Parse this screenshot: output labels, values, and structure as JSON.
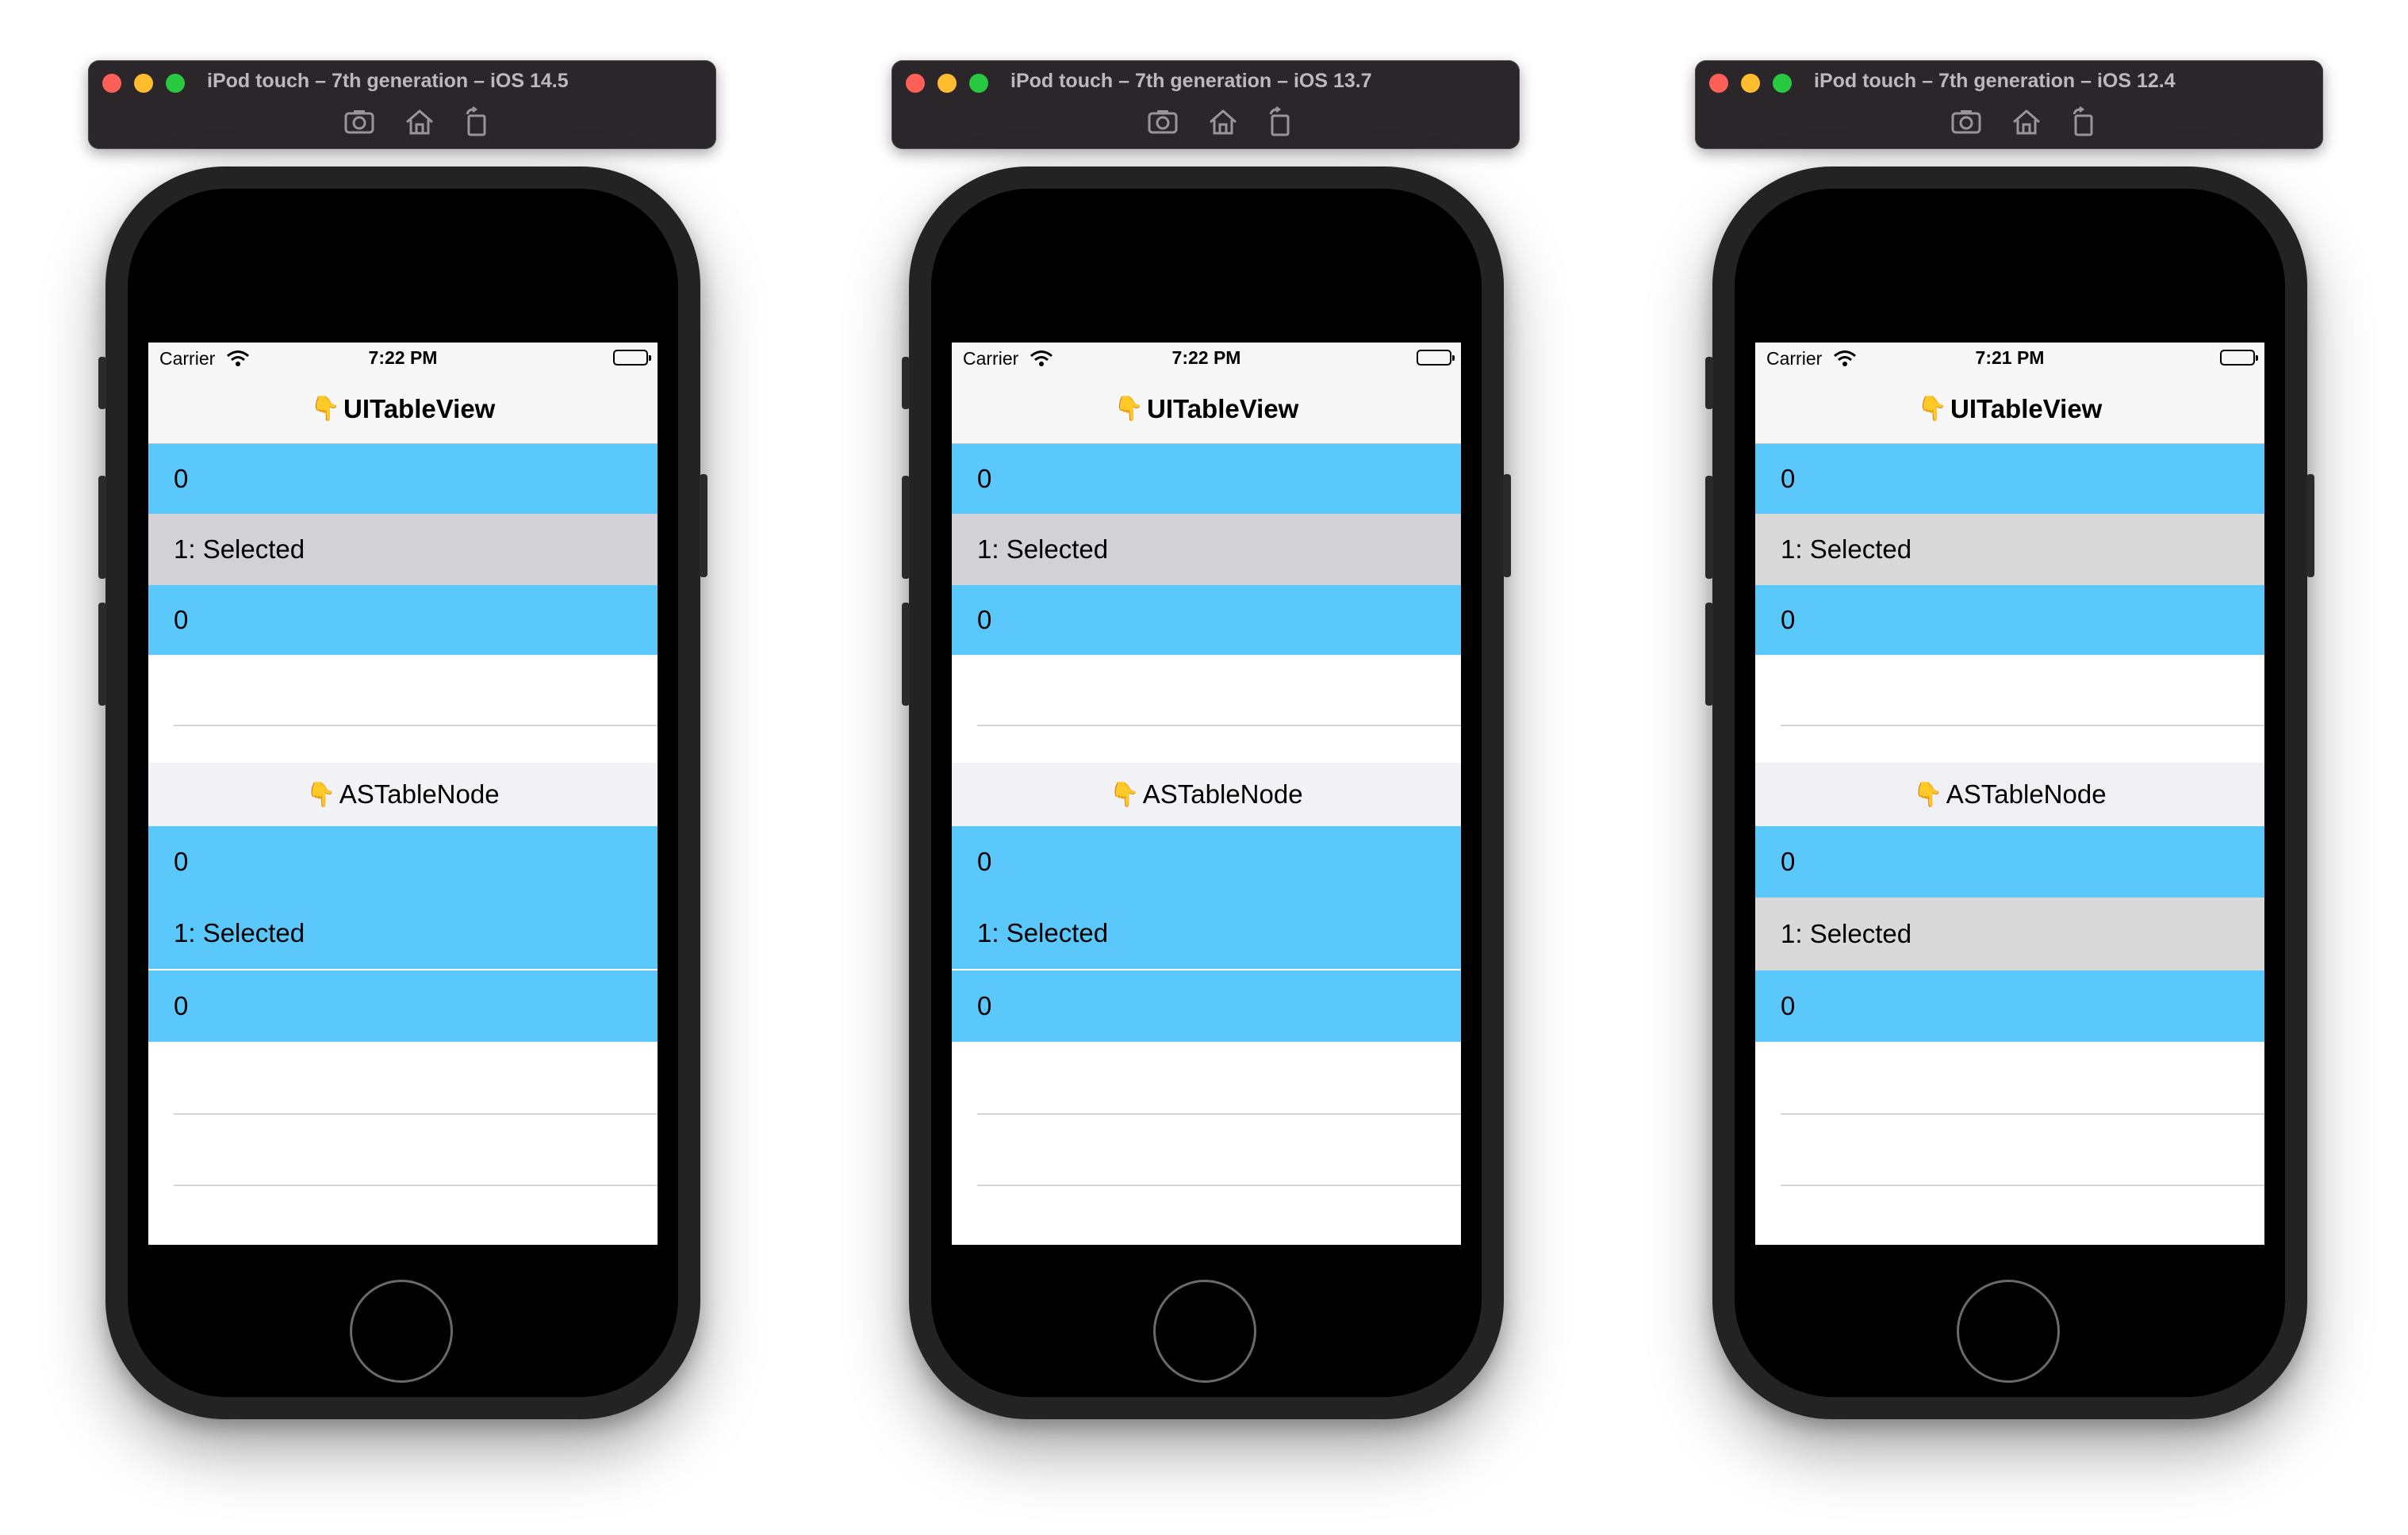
{
  "simulators": [
    {
      "title": "iPod touch – 7th generation – iOS 14.5",
      "status": {
        "carrier": "Carrier",
        "time": "7:22 PM"
      },
      "navbar_title": "UITableView",
      "table1_rows": [
        {
          "label": "0",
          "style": "blue"
        },
        {
          "label": "1: Selected",
          "style": "gray"
        },
        {
          "label": "0",
          "style": "blue"
        }
      ],
      "section_header": "ASTableNode",
      "table2_rows": [
        {
          "label": "0",
          "style": "blue"
        },
        {
          "label": "1: Selected",
          "style": "blue"
        },
        {
          "label": "0",
          "style": "blue"
        }
      ]
    },
    {
      "title": "iPod touch – 7th generation – iOS 13.7",
      "status": {
        "carrier": "Carrier",
        "time": "7:22 PM"
      },
      "navbar_title": "UITableView",
      "table1_rows": [
        {
          "label": "0",
          "style": "blue"
        },
        {
          "label": "1: Selected",
          "style": "gray"
        },
        {
          "label": "0",
          "style": "blue"
        }
      ],
      "section_header": "ASTableNode",
      "table2_rows": [
        {
          "label": "0",
          "style": "blue"
        },
        {
          "label": "1: Selected",
          "style": "blue"
        },
        {
          "label": "0",
          "style": "blue"
        }
      ]
    },
    {
      "title": "iPod touch – 7th generation – iOS 12.4",
      "status": {
        "carrier": "Carrier",
        "time": "7:21 PM"
      },
      "navbar_title": "UITableView",
      "table1_rows": [
        {
          "label": "0",
          "style": "blue"
        },
        {
          "label": "1: Selected",
          "style": "lightgray"
        },
        {
          "label": "0",
          "style": "blue"
        }
      ],
      "section_header": "ASTableNode",
      "table2_rows": [
        {
          "label": "0",
          "style": "blue"
        },
        {
          "label": "1: Selected",
          "style": "lightgray"
        },
        {
          "label": "0",
          "style": "blue"
        }
      ]
    }
  ],
  "icons": {
    "pointing_hand": "👇",
    "toolbar": [
      "screenshot-icon",
      "home-icon",
      "rotate-icon"
    ]
  },
  "colors": {
    "row_blue": "#5ac8fa",
    "row_selected_gray": "#d1d1d6",
    "toolbar_bg": "#2b2629"
  }
}
